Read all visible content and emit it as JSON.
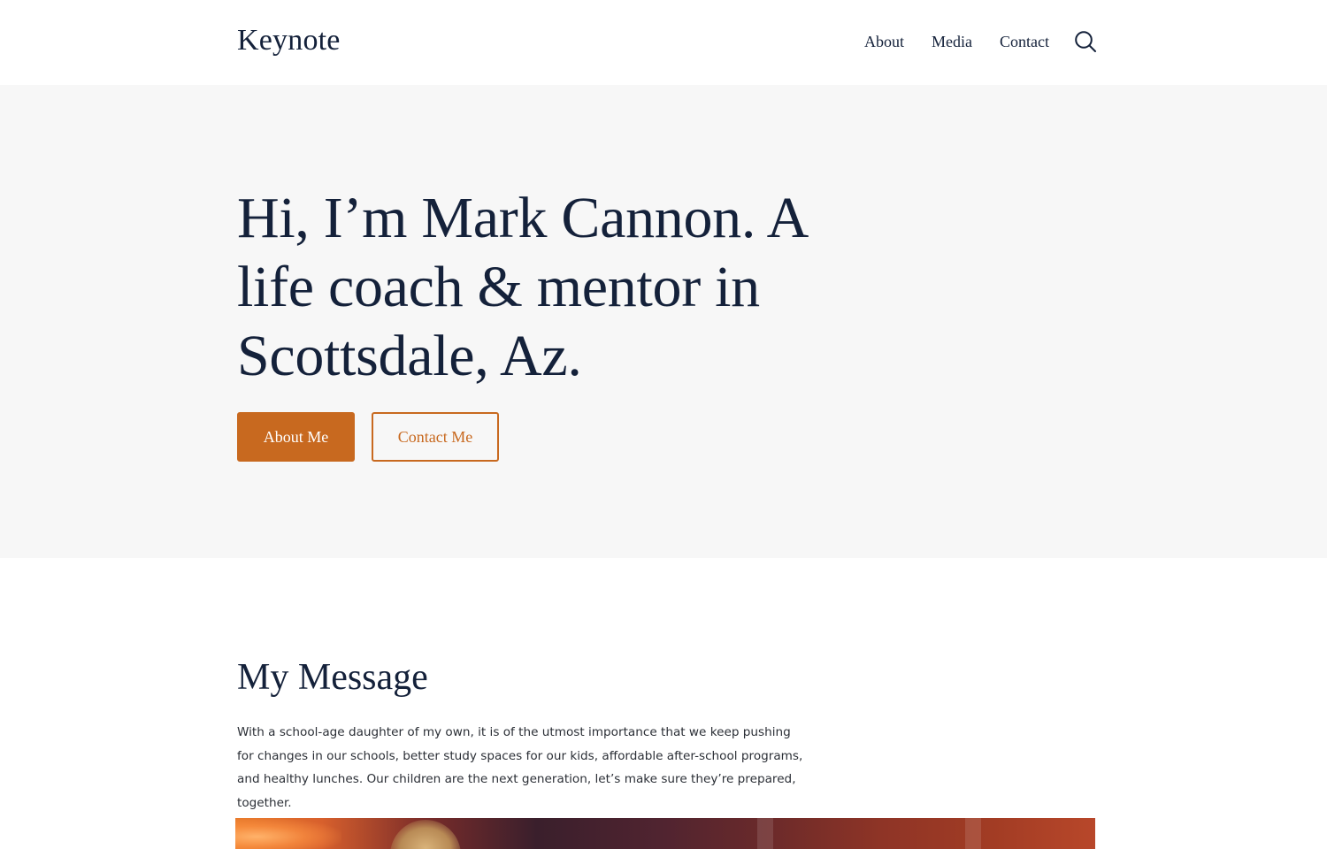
{
  "header": {
    "logo": "Keynote",
    "nav": [
      "About",
      "Media",
      "Contact"
    ],
    "search_icon": "search-icon"
  },
  "hero": {
    "title": "Hi, I’m Mark Cannon. A life coach & mentor in Scottsdale, Az.",
    "primary_button": "About Me",
    "secondary_button": "Contact Me"
  },
  "message": {
    "heading": "My Message",
    "body": "With a school-age daughter of my own, it is of the utmost importance that we keep pushing for changes in our schools, better study spaces for our kids, affordable after-school programs, and healthy lunches. Our children are the next generation, let’s make sure they’re prepared, together."
  },
  "colors": {
    "accent": "#c8691f",
    "text": "#14213a",
    "hero_bg": "#f7f7f7"
  }
}
